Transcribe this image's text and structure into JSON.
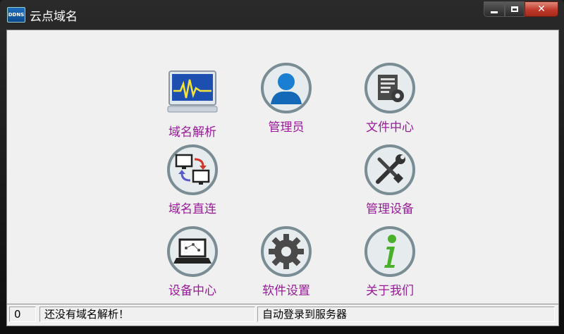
{
  "window": {
    "title": "云点域名",
    "app_icon_text": "DDNS"
  },
  "tiles": [
    {
      "label": "域名解析",
      "icon": "monitor-waveform-icon"
    },
    {
      "label": "管理员",
      "icon": "admin-user-icon"
    },
    {
      "label": "文件中心",
      "icon": "document-gear-icon"
    },
    {
      "label": "域名直连",
      "icon": "network-computers-icon"
    },
    {
      "label": "管理设备",
      "icon": "wrench-screwdriver-icon"
    },
    {
      "label": "设备中心",
      "icon": "laptop-icon"
    },
    {
      "label": "软件设置",
      "icon": "gear-icon"
    },
    {
      "label": "关于我们",
      "icon": "info-icon"
    }
  ],
  "statusbar": {
    "count": "0",
    "message": "还没有域名解析！",
    "login_status": "自动登录到服务器"
  },
  "colors": {
    "label": "#9b1a9b",
    "icon_ring": "#7a8c94"
  }
}
